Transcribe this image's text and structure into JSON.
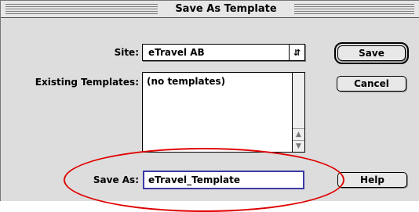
{
  "dialog": {
    "title": "Save As Template",
    "site_label": "Site:",
    "site_value": "eTravel AB",
    "existing_label": "Existing Templates:",
    "existing_items": [
      "(no templates)"
    ],
    "save_as_label": "Save As:",
    "save_as_value": "eTravel_Template"
  },
  "buttons": {
    "save": "Save",
    "cancel": "Cancel",
    "help": "Help"
  },
  "icons": {
    "popup_arrows": "updown-arrows-icon",
    "scroll_up": "scroll-up-arrow-icon",
    "scroll_down": "scroll-down-arrow-icon"
  },
  "colors": {
    "highlight_oval": "#e00000",
    "input_focus": "#3a3aa8"
  }
}
